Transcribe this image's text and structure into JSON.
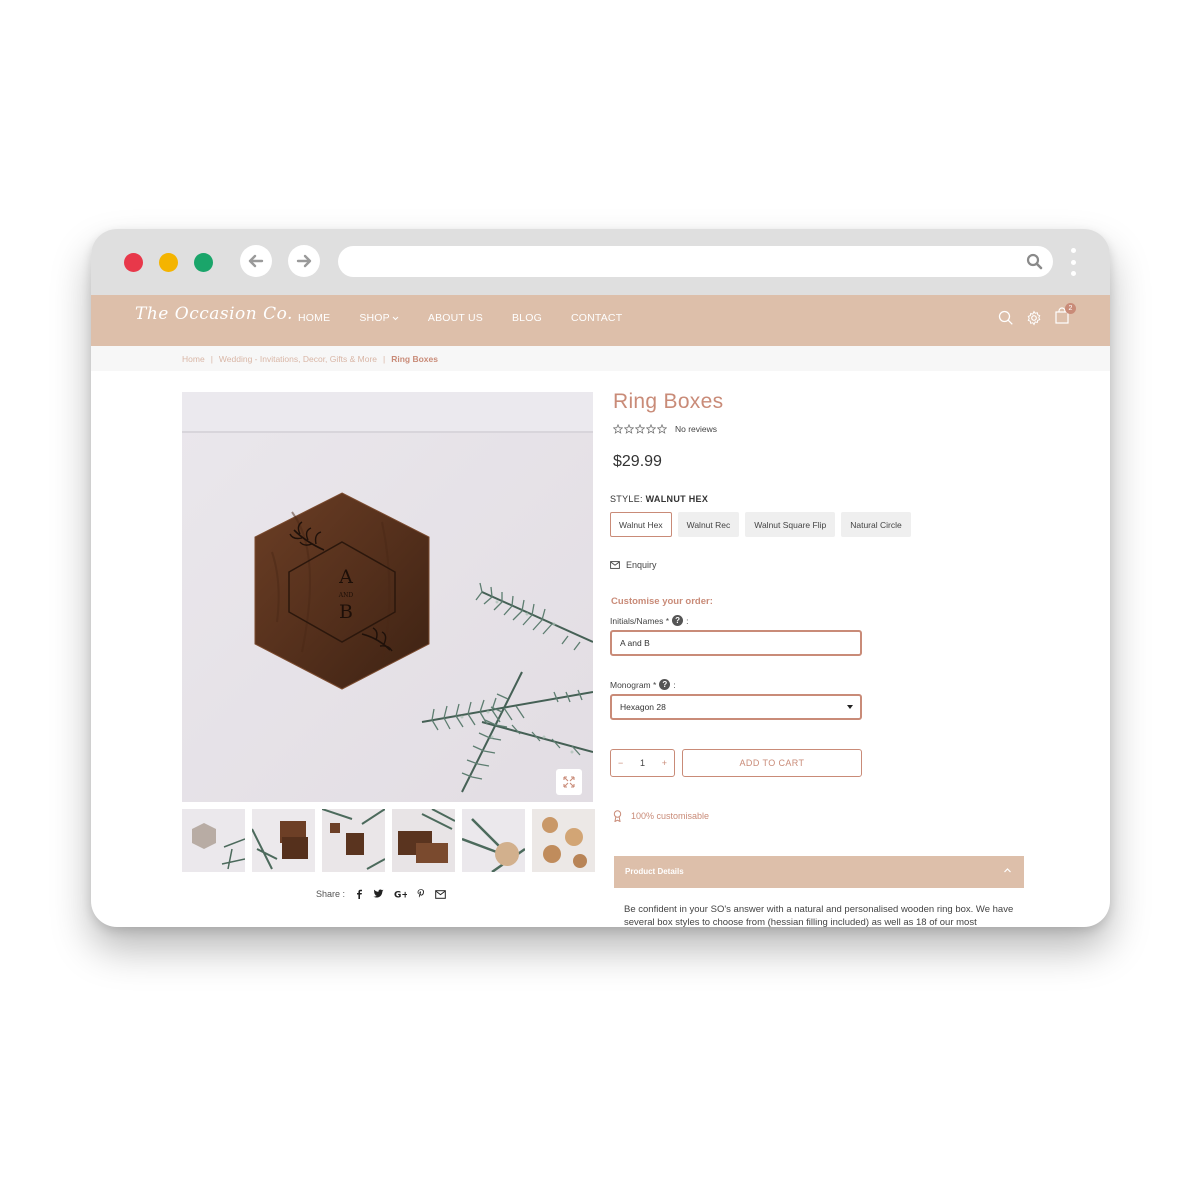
{
  "site": {
    "logo_text": "The Occasion Co.",
    "menu": [
      {
        "label": "HOME"
      },
      {
        "label": "SHOP"
      },
      {
        "label": "ABOUT US"
      },
      {
        "label": "BLOG"
      },
      {
        "label": "CONTACT"
      }
    ],
    "cart_count": "2"
  },
  "breadcrumb": {
    "home": "Home",
    "sep": "|",
    "category": "Wedding - Invitations, Decor, Gifts & More",
    "current": "Ring Boxes"
  },
  "product": {
    "title": "Ring Boxes",
    "reviews": "No reviews",
    "rating_stars": 0,
    "price": "$29.99",
    "style_label": "STYLE:",
    "style_value": "WALNUT HEX",
    "options": [
      "Walnut Hex",
      "Walnut Rec",
      "Walnut Square Flip",
      "Natural Circle"
    ],
    "selected_option": "Walnut Hex",
    "enquiry": "Enquiry",
    "customise_title": "Customise your order:",
    "initials_label": "Initials/Names *",
    "initials_value": "A and B",
    "monogram_label": "Monogram *",
    "monogram_value": "Hexagon 28",
    "quantity": "1",
    "qty_minus": "−",
    "qty_plus": "+",
    "add_to_cart": "ADD TO CART",
    "customisable": "100% customisable",
    "details_title": "Product Details",
    "description": "Be confident in your SO's answer with a natural and personalised wooden ring box. We have several box styles to choose from (hessian filling included) as well as 18 of our most",
    "box_initial_top": "A",
    "box_initial_mid": "AND",
    "box_initial_bottom": "B"
  },
  "share": {
    "label": "Share :"
  },
  "colors": {
    "accent": "#c98b78",
    "nav_bg": "#ddbfaa",
    "traffic_red": "#e8384a",
    "traffic_yellow": "#f4b400",
    "traffic_green": "#1aa56a"
  }
}
